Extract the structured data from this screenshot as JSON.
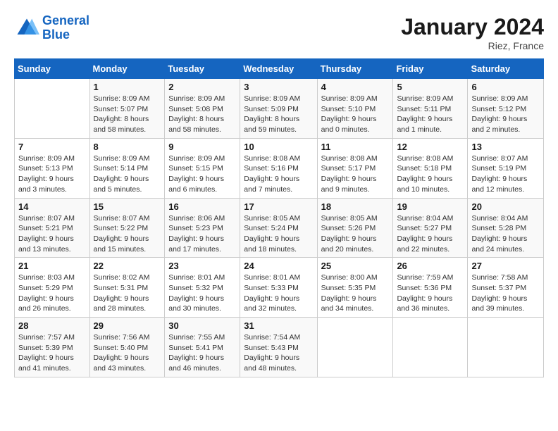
{
  "logo": {
    "line1": "General",
    "line2": "Blue"
  },
  "title": "January 2024",
  "location": "Riez, France",
  "days_header": [
    "Sunday",
    "Monday",
    "Tuesday",
    "Wednesday",
    "Thursday",
    "Friday",
    "Saturday"
  ],
  "weeks": [
    [
      {
        "day": "",
        "info": ""
      },
      {
        "day": "1",
        "info": "Sunrise: 8:09 AM\nSunset: 5:07 PM\nDaylight: 8 hours\nand 58 minutes."
      },
      {
        "day": "2",
        "info": "Sunrise: 8:09 AM\nSunset: 5:08 PM\nDaylight: 8 hours\nand 58 minutes."
      },
      {
        "day": "3",
        "info": "Sunrise: 8:09 AM\nSunset: 5:09 PM\nDaylight: 8 hours\nand 59 minutes."
      },
      {
        "day": "4",
        "info": "Sunrise: 8:09 AM\nSunset: 5:10 PM\nDaylight: 9 hours\nand 0 minutes."
      },
      {
        "day": "5",
        "info": "Sunrise: 8:09 AM\nSunset: 5:11 PM\nDaylight: 9 hours\nand 1 minute."
      },
      {
        "day": "6",
        "info": "Sunrise: 8:09 AM\nSunset: 5:12 PM\nDaylight: 9 hours\nand 2 minutes."
      }
    ],
    [
      {
        "day": "7",
        "info": "Sunrise: 8:09 AM\nSunset: 5:13 PM\nDaylight: 9 hours\nand 3 minutes."
      },
      {
        "day": "8",
        "info": "Sunrise: 8:09 AM\nSunset: 5:14 PM\nDaylight: 9 hours\nand 5 minutes."
      },
      {
        "day": "9",
        "info": "Sunrise: 8:09 AM\nSunset: 5:15 PM\nDaylight: 9 hours\nand 6 minutes."
      },
      {
        "day": "10",
        "info": "Sunrise: 8:08 AM\nSunset: 5:16 PM\nDaylight: 9 hours\nand 7 minutes."
      },
      {
        "day": "11",
        "info": "Sunrise: 8:08 AM\nSunset: 5:17 PM\nDaylight: 9 hours\nand 9 minutes."
      },
      {
        "day": "12",
        "info": "Sunrise: 8:08 AM\nSunset: 5:18 PM\nDaylight: 9 hours\nand 10 minutes."
      },
      {
        "day": "13",
        "info": "Sunrise: 8:07 AM\nSunset: 5:19 PM\nDaylight: 9 hours\nand 12 minutes."
      }
    ],
    [
      {
        "day": "14",
        "info": "Sunrise: 8:07 AM\nSunset: 5:21 PM\nDaylight: 9 hours\nand 13 minutes."
      },
      {
        "day": "15",
        "info": "Sunrise: 8:07 AM\nSunset: 5:22 PM\nDaylight: 9 hours\nand 15 minutes."
      },
      {
        "day": "16",
        "info": "Sunrise: 8:06 AM\nSunset: 5:23 PM\nDaylight: 9 hours\nand 17 minutes."
      },
      {
        "day": "17",
        "info": "Sunrise: 8:05 AM\nSunset: 5:24 PM\nDaylight: 9 hours\nand 18 minutes."
      },
      {
        "day": "18",
        "info": "Sunrise: 8:05 AM\nSunset: 5:26 PM\nDaylight: 9 hours\nand 20 minutes."
      },
      {
        "day": "19",
        "info": "Sunrise: 8:04 AM\nSunset: 5:27 PM\nDaylight: 9 hours\nand 22 minutes."
      },
      {
        "day": "20",
        "info": "Sunrise: 8:04 AM\nSunset: 5:28 PM\nDaylight: 9 hours\nand 24 minutes."
      }
    ],
    [
      {
        "day": "21",
        "info": "Sunrise: 8:03 AM\nSunset: 5:29 PM\nDaylight: 9 hours\nand 26 minutes."
      },
      {
        "day": "22",
        "info": "Sunrise: 8:02 AM\nSunset: 5:31 PM\nDaylight: 9 hours\nand 28 minutes."
      },
      {
        "day": "23",
        "info": "Sunrise: 8:01 AM\nSunset: 5:32 PM\nDaylight: 9 hours\nand 30 minutes."
      },
      {
        "day": "24",
        "info": "Sunrise: 8:01 AM\nSunset: 5:33 PM\nDaylight: 9 hours\nand 32 minutes."
      },
      {
        "day": "25",
        "info": "Sunrise: 8:00 AM\nSunset: 5:35 PM\nDaylight: 9 hours\nand 34 minutes."
      },
      {
        "day": "26",
        "info": "Sunrise: 7:59 AM\nSunset: 5:36 PM\nDaylight: 9 hours\nand 36 minutes."
      },
      {
        "day": "27",
        "info": "Sunrise: 7:58 AM\nSunset: 5:37 PM\nDaylight: 9 hours\nand 39 minutes."
      }
    ],
    [
      {
        "day": "28",
        "info": "Sunrise: 7:57 AM\nSunset: 5:39 PM\nDaylight: 9 hours\nand 41 minutes."
      },
      {
        "day": "29",
        "info": "Sunrise: 7:56 AM\nSunset: 5:40 PM\nDaylight: 9 hours\nand 43 minutes."
      },
      {
        "day": "30",
        "info": "Sunrise: 7:55 AM\nSunset: 5:41 PM\nDaylight: 9 hours\nand 46 minutes."
      },
      {
        "day": "31",
        "info": "Sunrise: 7:54 AM\nSunset: 5:43 PM\nDaylight: 9 hours\nand 48 minutes."
      },
      {
        "day": "",
        "info": ""
      },
      {
        "day": "",
        "info": ""
      },
      {
        "day": "",
        "info": ""
      }
    ]
  ]
}
